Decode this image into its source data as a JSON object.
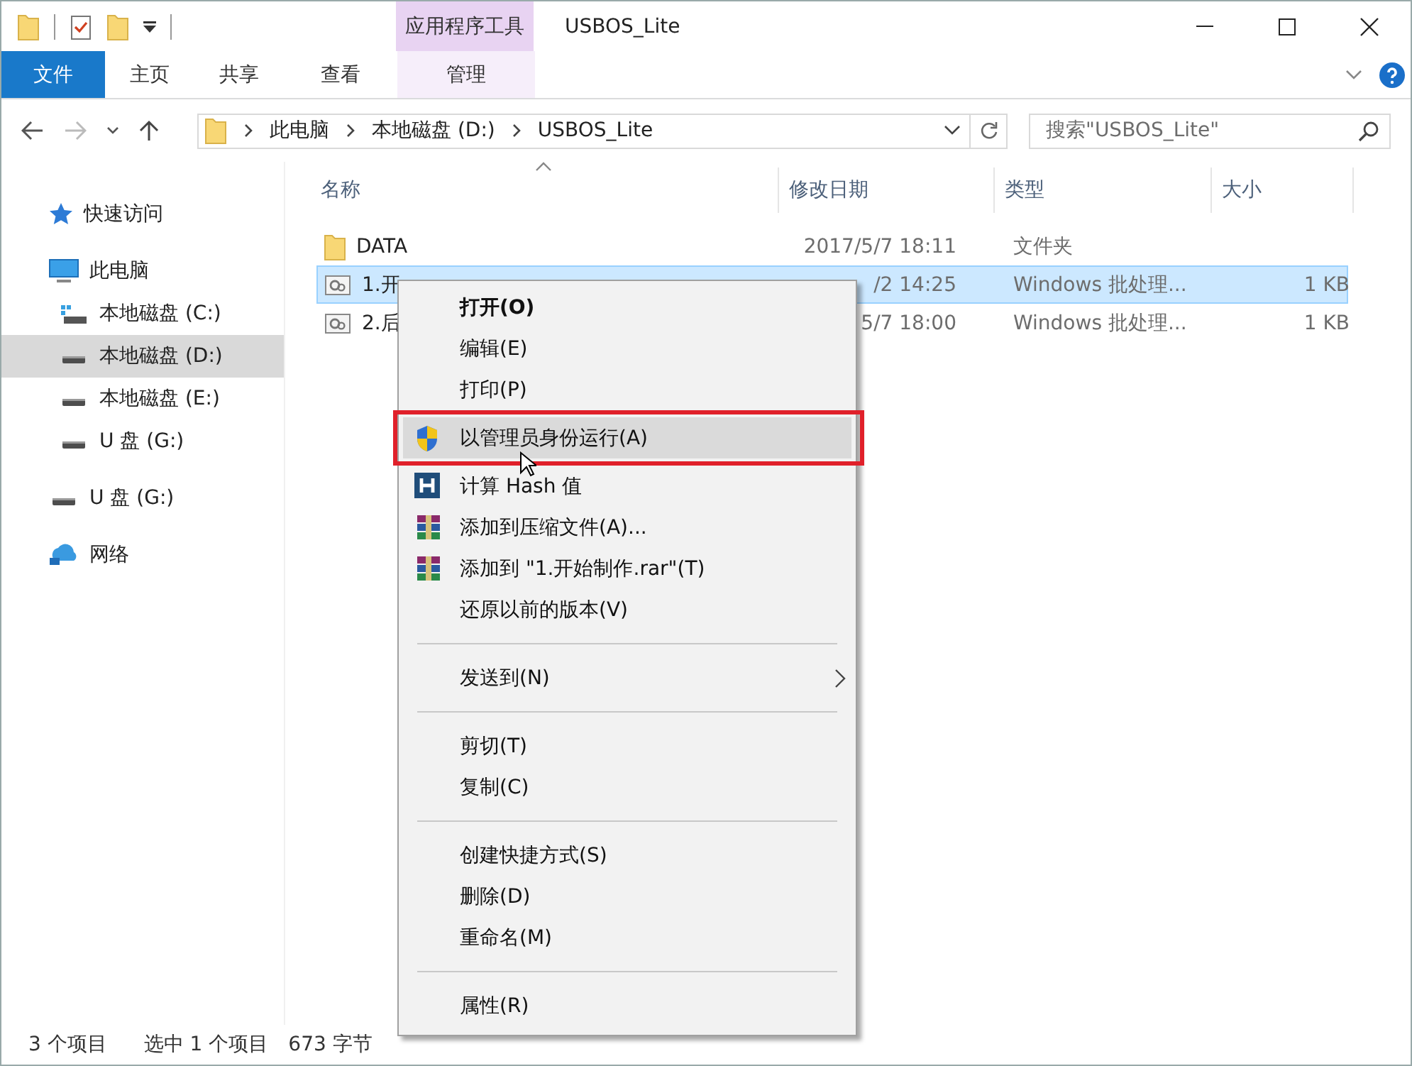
{
  "window": {
    "title": "USBOS_Lite"
  },
  "ribbon": {
    "context_group": "应用程序工具",
    "tabs": [
      {
        "label": "文件",
        "kind": "file"
      },
      {
        "label": "主页",
        "kind": "normal"
      },
      {
        "label": "共享",
        "kind": "normal"
      },
      {
        "label": "查看",
        "kind": "normal"
      },
      {
        "label": "管理",
        "kind": "contextual"
      }
    ]
  },
  "address": {
    "crumbs": [
      "此电脑",
      "本地磁盘 (D:)",
      "USBOS_Lite"
    ],
    "search": {
      "placeholder": "搜索\"USBOS_Lite\""
    }
  },
  "sidebar": {
    "items": [
      {
        "label": "快速访问",
        "kind": "star",
        "selected": false
      },
      {
        "label": "此电脑",
        "kind": "pc",
        "selected": false,
        "children": [
          {
            "label": "本地磁盘 (C:)",
            "kind": "system-drive",
            "selected": false
          },
          {
            "label": "本地磁盘 (D:)",
            "kind": "drive",
            "selected": true
          },
          {
            "label": "本地磁盘 (E:)",
            "kind": "drive",
            "selected": false
          },
          {
            "label": "U 盘 (G:)",
            "kind": "drive",
            "selected": false
          }
        ]
      },
      {
        "label": "U 盘 (G:)",
        "kind": "drive",
        "selected": false
      },
      {
        "label": "网络",
        "kind": "network",
        "selected": false
      }
    ]
  },
  "file_list": {
    "columns": [
      "名称",
      "修改日期",
      "类型",
      "大小"
    ],
    "rows": [
      {
        "name": "DATA",
        "kind": "folder",
        "date": "2017/5/7 18:11",
        "type": "文件夹",
        "selected": false
      },
      {
        "name": "1.开",
        "kind": "batch",
        "date": "/2 14:25",
        "type": "Windows 批处理...",
        "size": "1 KB",
        "selected": true
      },
      {
        "name": "2.后",
        "kind": "batch",
        "date": "5/7 18:00",
        "type": "Windows 批处理...",
        "size": "1 KB",
        "selected": false
      }
    ]
  },
  "context_menu": {
    "items": [
      {
        "label": "打开(O)",
        "kind": "default",
        "selected": false,
        "outlined": false
      },
      {
        "label": "编辑(E)",
        "kind": "plain",
        "selected": false,
        "outlined": false
      },
      {
        "label": "打印(P)",
        "kind": "plain",
        "selected": false,
        "outlined": false
      },
      {
        "label": "以管理员身份运行(A)",
        "kind": "shield",
        "selected": true,
        "outlined": true
      },
      {
        "label": "计算 Hash 值",
        "kind": "hash",
        "selected": false,
        "outlined": false
      },
      {
        "label": "添加到压缩文件(A)...",
        "kind": "archive",
        "selected": false,
        "outlined": false
      },
      {
        "label": "添加到 \"1.开始制作.rar\"(T)",
        "kind": "archive",
        "selected": false,
        "outlined": false
      },
      {
        "label": "还原以前的版本(V)",
        "kind": "plain",
        "selected": false,
        "outlined": false
      },
      {
        "kind": "separator"
      },
      {
        "label": "发送到(N)",
        "kind": "submenu",
        "selected": false,
        "outlined": false
      },
      {
        "kind": "separator"
      },
      {
        "label": "剪切(T)",
        "kind": "plain",
        "selected": false,
        "outlined": false
      },
      {
        "label": "复制(C)",
        "kind": "plain",
        "selected": false,
        "outlined": false
      },
      {
        "kind": "separator"
      },
      {
        "label": "创建快捷方式(S)",
        "kind": "plain",
        "selected": false,
        "outlined": false
      },
      {
        "label": "删除(D)",
        "kind": "plain",
        "selected": false,
        "outlined": false
      },
      {
        "label": "重命名(M)",
        "kind": "plain",
        "selected": false,
        "outlined": false
      },
      {
        "kind": "separator"
      },
      {
        "label": "属性(R)",
        "kind": "plain",
        "selected": false,
        "outlined": false
      }
    ]
  },
  "status_bar": {
    "item_count": "3 个项目",
    "selection": "选中 1 个项目",
    "selection_size": "673 字节"
  }
}
